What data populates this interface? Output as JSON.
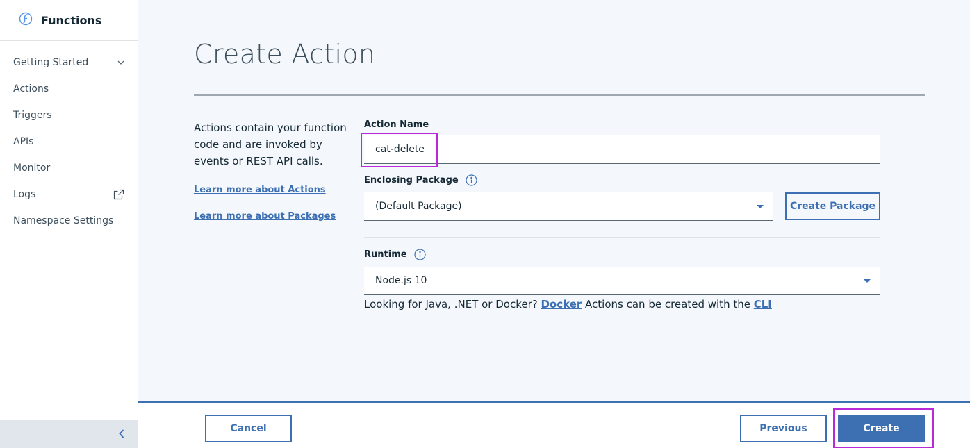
{
  "app": {
    "brand_title": "Functions",
    "brand_icon": "functions-logo-icon"
  },
  "sidebar": {
    "items": [
      {
        "label": "Getting Started",
        "icon": "chevron-down-icon"
      },
      {
        "label": "Actions"
      },
      {
        "label": "Triggers"
      },
      {
        "label": "APIs"
      },
      {
        "label": "Monitor"
      },
      {
        "label": "Logs",
        "icon": "external-link-icon"
      },
      {
        "label": "Namespace Settings"
      }
    ],
    "collapse_icon": "chevron-left-icon"
  },
  "main": {
    "title": "Create Action",
    "description": "Actions contain your function code and are invoked by events or REST API calls.",
    "links": {
      "actions": "Learn more about Actions",
      "packages": "Learn more about Packages"
    },
    "action_name": {
      "label": "Action Name",
      "value": "cat-delete"
    },
    "enclosing_package": {
      "label": "Enclosing Package",
      "selected": "(Default Package)",
      "create_button": "Create Package"
    },
    "runtime": {
      "label": "Runtime",
      "selected": "Node.js 10"
    },
    "hint": {
      "prefix": "Looking for Java, .NET or Docker? ",
      "docker_link": "Docker",
      "middle": " Actions can be created with the ",
      "cli_link": "CLI"
    }
  },
  "footer": {
    "cancel": "Cancel",
    "previous": "Previous",
    "create": "Create"
  },
  "colors": {
    "accent": "#3d70b2",
    "highlight": "#b729d9",
    "text": "#152935"
  }
}
